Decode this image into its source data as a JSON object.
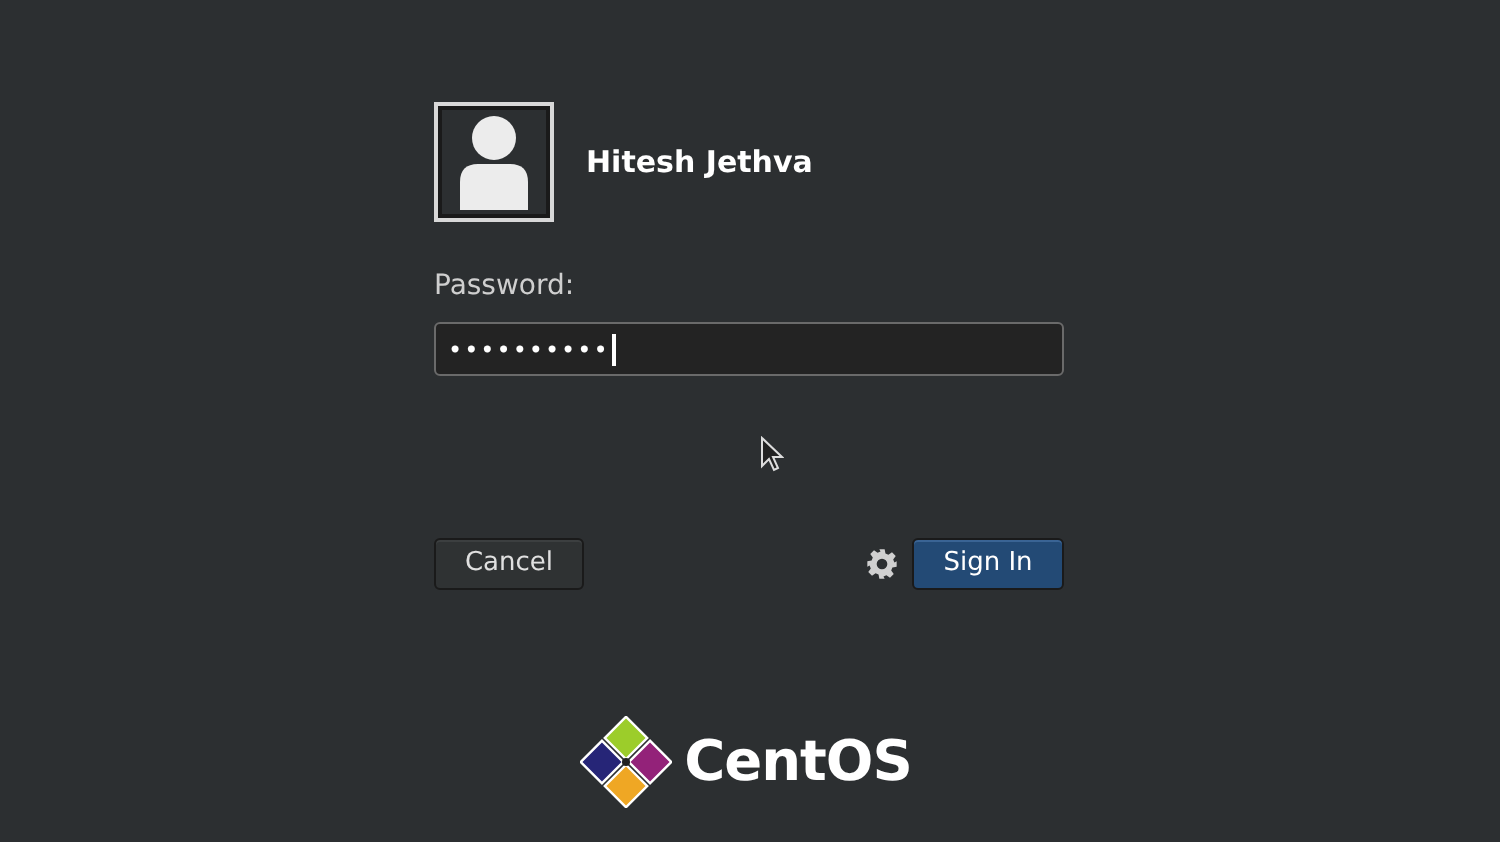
{
  "user": {
    "name": "Hitesh Jethva"
  },
  "password": {
    "label": "Password:",
    "value": "••••••••••",
    "focused": true
  },
  "buttons": {
    "cancel": "Cancel",
    "sign_in": "Sign In"
  },
  "logo": {
    "text": "CentOS"
  }
}
